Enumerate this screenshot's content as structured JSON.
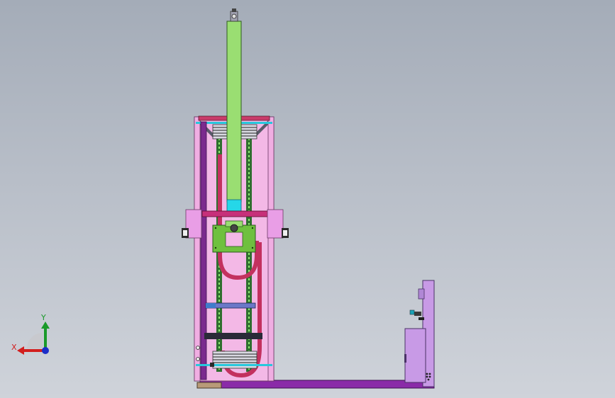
{
  "viewport": {
    "background_top": "#a4acb8",
    "background_bottom": "#cfd3da"
  },
  "colors": {
    "frame_pink": "#f3b8e6",
    "frame_outline": "#6c3a66",
    "bracket_pink": "#e99ee6",
    "cylinder_green": "#9ade72",
    "cyan_block": "#25d7e8",
    "rail_green": "#3a8a3a",
    "carriage_green": "#6fc03f",
    "cable_crimson": "#c3315f",
    "crossbar_magenta": "#c7307a",
    "post_purple": "#7b2a8e",
    "base_violet": "#8a2ba8",
    "cabinet_lavender": "#c89ae6",
    "beam_dark": "#2a2a38",
    "beam_blue": "#3f7ccc"
  },
  "triad": {
    "x_label": "X",
    "y_label": "Y",
    "x_color": "#d21e1e",
    "y_color": "#1a9a2a",
    "z_color": "#1c2ec8"
  }
}
